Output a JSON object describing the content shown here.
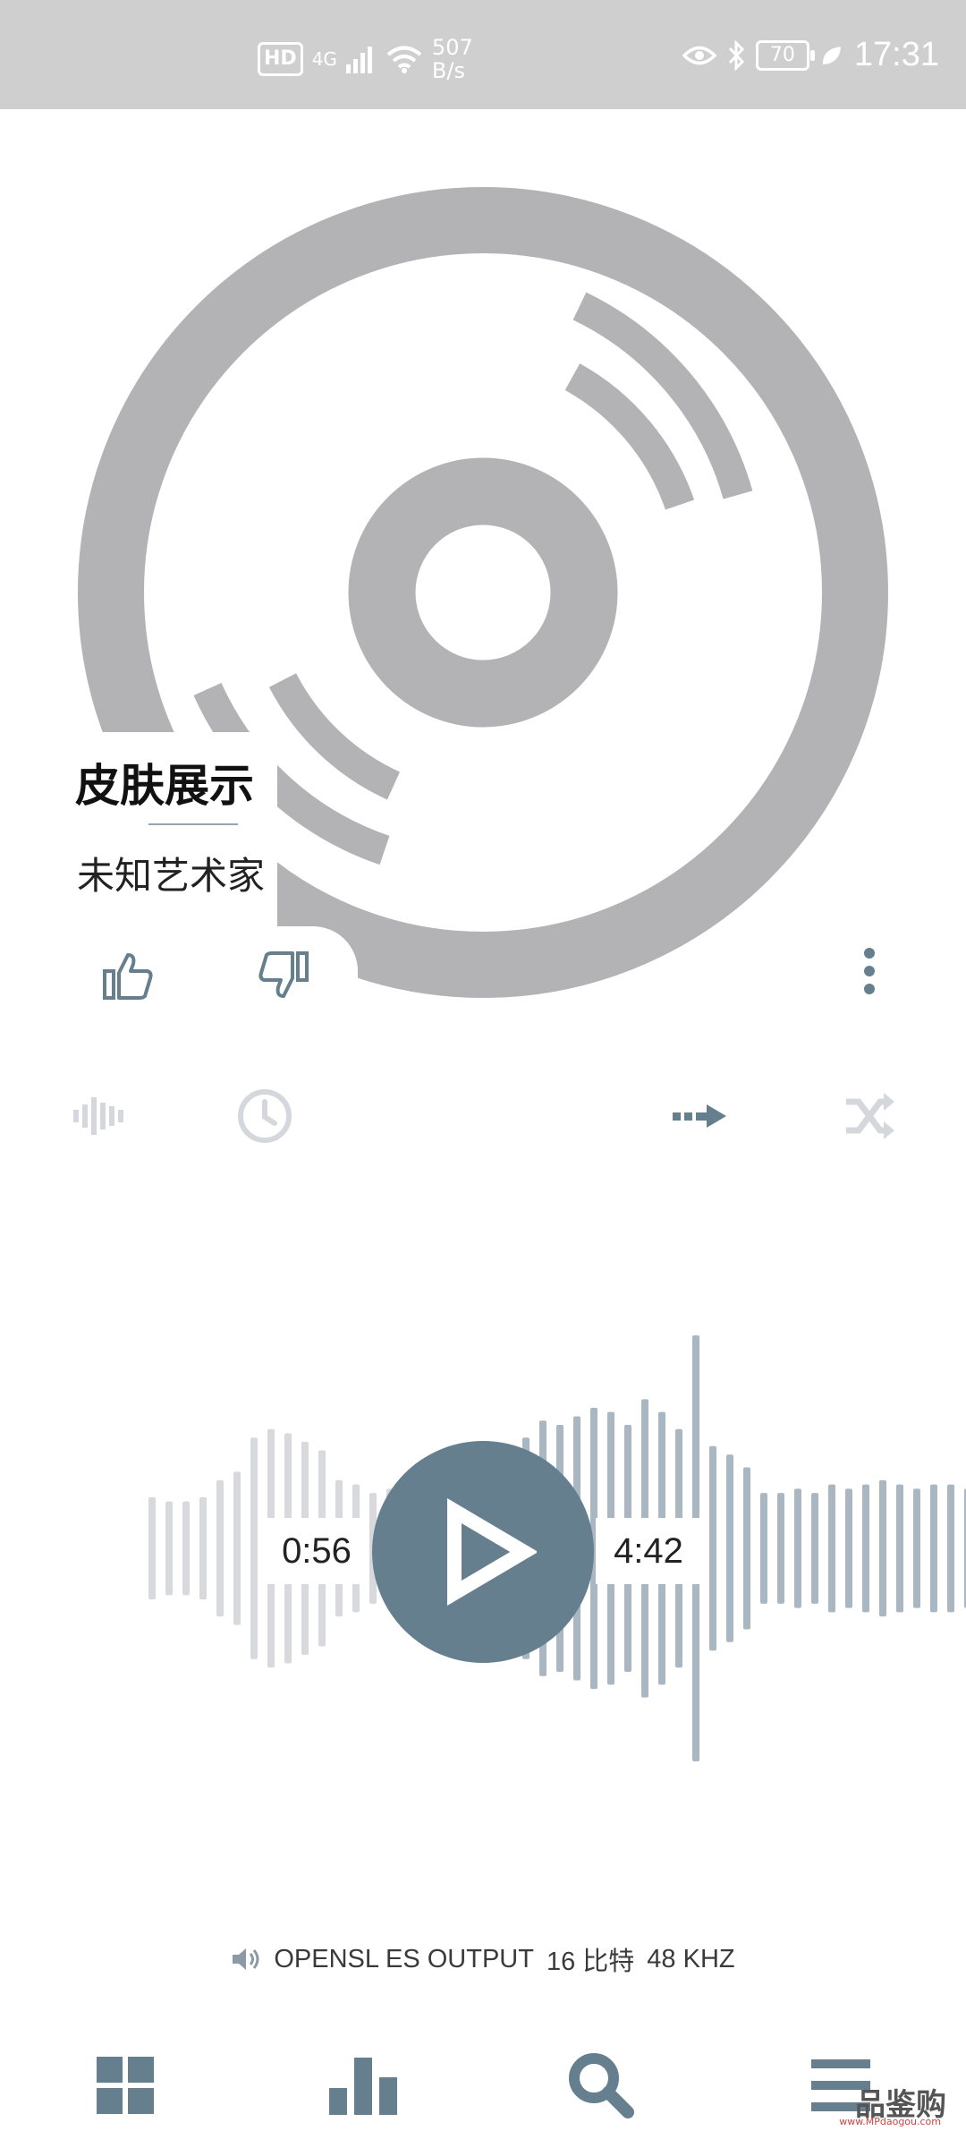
{
  "status_bar": {
    "hd": "HD",
    "network": "4G",
    "rate_value": "507",
    "rate_unit": "B/s",
    "battery": "70",
    "time": "17:31"
  },
  "track": {
    "title": "皮肤展示",
    "artist": "未知艺术家"
  },
  "player": {
    "elapsed": "0:56",
    "duration": "4:42",
    "progress": 0.199
  },
  "audio_info": {
    "output": "OPENSL ES OUTPUT",
    "bit_depth": "16 比特",
    "sample_rate": "48 KHZ"
  },
  "watermark": {
    "text": "品鉴购",
    "url": "www.MPdaogou.com"
  },
  "colors": {
    "accent": "#667f8f",
    "disc": "#b3b3b6",
    "wave_played": "#d7d9dc",
    "wave_remaining": "#a9b7c2",
    "icon_muted": "#d4d8dc",
    "status_bar": "#cfcfcf"
  },
  "icons": {
    "like": "thumbs-up-icon",
    "dislike": "thumbs-down-icon",
    "more": "more-vertical-icon",
    "equalizer": "waveform-icon",
    "sleep_timer": "clock-icon",
    "repeat_mode": "play-order-arrow-icon",
    "shuffle": "shuffle-icon",
    "play": "play-icon",
    "volume": "speaker-icon",
    "library": "grid-icon",
    "stats": "bar-chart-icon",
    "search": "search-icon",
    "menu": "menu-icon"
  }
}
